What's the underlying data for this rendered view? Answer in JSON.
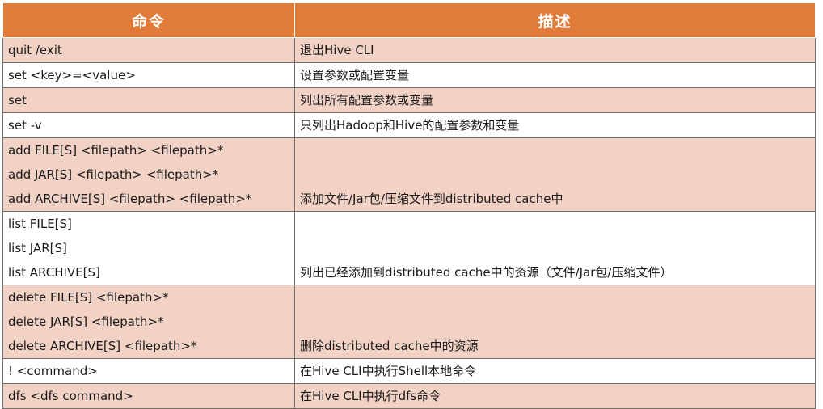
{
  "header": {
    "command": "命令",
    "description": "描述"
  },
  "rows": [
    {
      "commands": [
        "quit /exit"
      ],
      "description": "退出Hive CLI"
    },
    {
      "commands": [
        "set <key>=<value>"
      ],
      "description": "设置参数或配置变量"
    },
    {
      "commands": [
        "set"
      ],
      "description": "列出所有配置参数或变量"
    },
    {
      "commands": [
        "set -v"
      ],
      "description": "只列出Hadoop和Hive的配置参数和变量"
    },
    {
      "commands": [
        "add FILE[S] <filepath> <filepath>*",
        "add JAR[S] <filepath> <filepath>*",
        "add ARCHIVE[S] <filepath> <filepath>*"
      ],
      "description": "添加文件/Jar包/压缩文件到distributed cache中"
    },
    {
      "commands": [
        "list FILE[S]",
        "list JAR[S]",
        "list ARCHIVE[S]"
      ],
      "description": "列出已经添加到distributed cache中的资源（文件/Jar包/压缩文件）"
    },
    {
      "commands": [
        "delete FILE[S] <filepath>*",
        "delete JAR[S] <filepath>*",
        "delete ARCHIVE[S] <filepath>*"
      ],
      "description": "删除distributed cache中的资源"
    },
    {
      "commands": [
        "! <command>"
      ],
      "description": "在Hive CLI中执行Shell本地命令"
    },
    {
      "commands": [
        "dfs <dfs command>"
      ],
      "description": "在Hive CLI中执行dfs命令"
    }
  ]
}
